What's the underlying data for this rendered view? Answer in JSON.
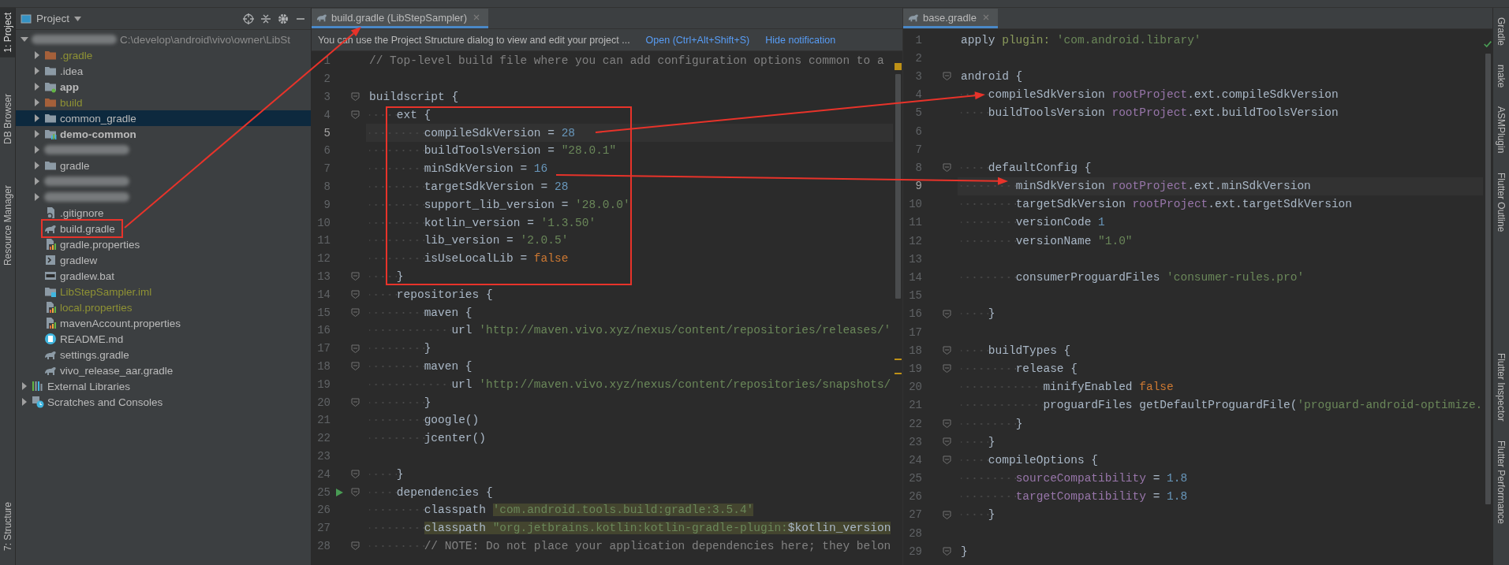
{
  "left_toolstrip": [
    {
      "label": "1: Project",
      "selected": true
    },
    {
      "label": "DB Browser",
      "selected": false
    },
    {
      "label": "Resource Manager",
      "selected": false
    },
    {
      "label": "7: Structure",
      "selected": false
    }
  ],
  "project_panel": {
    "title": "Project",
    "tree": [
      {
        "kind": "root",
        "redacted": true,
        "path": "C:\\develop\\android\\vivo\\owner\\LibSt",
        "expanded": true,
        "selected": false,
        "children": [
          {
            "kind": "excluded-folder",
            "label": ".gradle",
            "ignored": true,
            "expanded": false,
            "selected": false
          },
          {
            "kind": "folder",
            "label": ".idea",
            "expanded": false,
            "selected": false
          },
          {
            "kind": "module",
            "label": "app",
            "expanded": false,
            "selected": false
          },
          {
            "kind": "excluded-folder",
            "label": "build",
            "ignored": true,
            "expanded": false,
            "selected": false
          },
          {
            "kind": "folder",
            "label": "common_gradle",
            "expanded": false,
            "selected": true
          },
          {
            "kind": "module-lib",
            "label": "demo-common",
            "expanded": false,
            "selected": false
          },
          {
            "kind": "module-lib",
            "redacted": true,
            "expanded": false,
            "selected": false
          },
          {
            "kind": "folder",
            "label": "gradle",
            "expanded": false,
            "selected": false
          },
          {
            "kind": "module-lib",
            "redacted": true,
            "expanded": false,
            "selected": false
          },
          {
            "kind": "module-lib",
            "redacted": true,
            "expanded": false,
            "selected": false
          },
          {
            "kind": "ignore-file",
            "label": ".gitignore",
            "selected": false
          },
          {
            "kind": "gradle",
            "label": "build.gradle",
            "selected": false
          },
          {
            "kind": "properties",
            "label": "gradle.properties",
            "selected": false
          },
          {
            "kind": "script",
            "label": "gradlew",
            "selected": false
          },
          {
            "kind": "batch",
            "label": "gradlew.bat",
            "selected": false
          },
          {
            "kind": "iml",
            "label": "LibStepSampler.iml",
            "ignored": true,
            "selected": false
          },
          {
            "kind": "properties",
            "label": "local.properties",
            "ignored": true,
            "selected": false
          },
          {
            "kind": "properties",
            "label": "mavenAccount.properties",
            "selected": false
          },
          {
            "kind": "markdown",
            "label": "README.md",
            "selected": false
          },
          {
            "kind": "gradle",
            "label": "settings.gradle",
            "selected": false
          },
          {
            "kind": "gradle",
            "label": "vivo_release_aar.gradle",
            "selected": false
          }
        ]
      },
      {
        "kind": "libraries",
        "label": "External Libraries",
        "expanded": false,
        "selected": false
      },
      {
        "kind": "scratches",
        "label": "Scratches and Consoles",
        "expanded": false,
        "selected": false
      }
    ]
  },
  "left_editor": {
    "tab": "build.gradle (LibStepSampler)",
    "notification": {
      "text": "You can use the Project Structure dialog to view and edit your project ...",
      "links": [
        "Open (Ctrl+Alt+Shift+S)",
        "Hide notification"
      ]
    },
    "lines": [
      {
        "n": "1",
        "tokens": [
          {
            "t": "// Top-level build file where you can add configuration options common to a",
            "kind": "comment"
          }
        ]
      },
      {
        "n": "2"
      },
      {
        "n": "3",
        "fold": true,
        "tokens": [
          {
            "t": "buildscript {",
            "kind": "plain"
          }
        ]
      },
      {
        "n": "4",
        "fold": true,
        "tokens": [
          {
            "t": "    ext {",
            "kind": "plain"
          }
        ]
      },
      {
        "n": "5",
        "current": true,
        "tokens": [
          {
            "t": "        compileSdkVersion = ",
            "kind": "plain"
          },
          {
            "t": "28",
            "kind": "number"
          }
        ]
      },
      {
        "n": "6",
        "tokens": [
          {
            "t": "        buildToolsVersion = ",
            "kind": "plain"
          },
          {
            "t": "\"28.0.1\"",
            "kind": "string"
          }
        ]
      },
      {
        "n": "7",
        "tokens": [
          {
            "t": "        minSdkVersion = ",
            "kind": "plain"
          },
          {
            "t": "16",
            "kind": "number"
          }
        ]
      },
      {
        "n": "8",
        "tokens": [
          {
            "t": "        targetSdkVersion = ",
            "kind": "plain"
          },
          {
            "t": "28",
            "kind": "number"
          }
        ]
      },
      {
        "n": "9",
        "tokens": [
          {
            "t": "        support_lib_version = ",
            "kind": "plain"
          },
          {
            "t": "'28.0.0'",
            "kind": "string"
          }
        ]
      },
      {
        "n": "10",
        "tokens": [
          {
            "t": "        kotlin_version = ",
            "kind": "plain"
          },
          {
            "t": "'1.3.50'",
            "kind": "string"
          }
        ]
      },
      {
        "n": "11",
        "tokens": [
          {
            "t": "        lib_version = ",
            "kind": "plain"
          },
          {
            "t": "'2.0.5'",
            "kind": "string"
          }
        ]
      },
      {
        "n": "12",
        "tokens": [
          {
            "t": "        isUseLocalLib = ",
            "kind": "plain"
          },
          {
            "t": "false",
            "kind": "keyword"
          }
        ]
      },
      {
        "n": "13",
        "fold": true,
        "tokens": [
          {
            "t": "    }",
            "kind": "plain"
          }
        ]
      },
      {
        "n": "14",
        "fold": true,
        "tokens": [
          {
            "t": "    repositories {",
            "kind": "plain"
          }
        ]
      },
      {
        "n": "15",
        "fold": true,
        "tokens": [
          {
            "t": "        maven {",
            "kind": "plain"
          }
        ]
      },
      {
        "n": "16",
        "tokens": [
          {
            "t": "            url ",
            "kind": "plain"
          },
          {
            "t": "'http://maven.vivo.xyz/nexus/content/repositories/releases/'",
            "kind": "string"
          }
        ]
      },
      {
        "n": "17",
        "fold": true,
        "tokens": [
          {
            "t": "        }",
            "kind": "plain"
          }
        ]
      },
      {
        "n": "18",
        "fold": true,
        "tokens": [
          {
            "t": "        maven {",
            "kind": "plain"
          }
        ]
      },
      {
        "n": "19",
        "tokens": [
          {
            "t": "            url ",
            "kind": "plain"
          },
          {
            "t": "'http://maven.vivo.xyz/nexus/content/repositories/snapshots/",
            "kind": "string"
          }
        ]
      },
      {
        "n": "20",
        "fold": true,
        "tokens": [
          {
            "t": "        }",
            "kind": "plain"
          }
        ]
      },
      {
        "n": "21",
        "tokens": [
          {
            "t": "        google()",
            "kind": "plain"
          }
        ]
      },
      {
        "n": "22",
        "tokens": [
          {
            "t": "        jcenter()",
            "kind": "plain"
          }
        ]
      },
      {
        "n": "23"
      },
      {
        "n": "24",
        "fold": true,
        "tokens": [
          {
            "t": "    }",
            "kind": "plain"
          }
        ]
      },
      {
        "n": "25",
        "fold": true,
        "run": true,
        "tokens": [
          {
            "t": "    dependencies {",
            "kind": "plain"
          }
        ]
      },
      {
        "n": "26",
        "tokens": [
          {
            "t": "        classpath ",
            "kind": "plain"
          },
          {
            "t": "'com.android.tools.build:gradle:3.5.4'",
            "kind": "string",
            "marked": true
          }
        ]
      },
      {
        "n": "27",
        "tokens": [
          {
            "t": "        classpath ",
            "kind": "plain",
            "marked": true
          },
          {
            "t": "\"org.jetbrains.kotlin:kotlin-gradle-plugin:",
            "kind": "string",
            "marked": true
          },
          {
            "t": "$kotlin_version",
            "kind": "plain",
            "marked": true
          }
        ]
      },
      {
        "n": "28",
        "fold": true,
        "tokens": [
          {
            "t": "        // NOTE: Do not place your application dependencies here; they belon",
            "kind": "comment"
          }
        ]
      }
    ]
  },
  "right_editor": {
    "tab": "base.gradle",
    "lines": [
      {
        "n": "1",
        "tokens": [
          {
            "t": "apply ",
            "kind": "plain"
          },
          {
            "t": "plugin: ",
            "kind": "named"
          },
          {
            "t": "'com.android.library'",
            "kind": "string"
          }
        ]
      },
      {
        "n": "2"
      },
      {
        "n": "3",
        "fold": true,
        "tokens": [
          {
            "t": "android {",
            "kind": "plain"
          }
        ]
      },
      {
        "n": "4",
        "tokens": [
          {
            "t": "    compileSdkVersion ",
            "kind": "plain"
          },
          {
            "t": "rootProject",
            "kind": "property"
          },
          {
            "t": ".ext.compileSdkVersion",
            "kind": "plain"
          }
        ]
      },
      {
        "n": "5",
        "tokens": [
          {
            "t": "    buildToolsVersion ",
            "kind": "plain"
          },
          {
            "t": "rootProject",
            "kind": "property"
          },
          {
            "t": ".ext.buildToolsVersion",
            "kind": "plain"
          }
        ]
      },
      {
        "n": "6"
      },
      {
        "n": "7"
      },
      {
        "n": "8",
        "fold": true,
        "tokens": [
          {
            "t": "    defaultConfig {",
            "kind": "plain"
          }
        ]
      },
      {
        "n": "9",
        "current": true,
        "tokens": [
          {
            "t": "        minSdkVersion ",
            "kind": "plain"
          },
          {
            "t": "rootProject",
            "kind": "property"
          },
          {
            "t": ".ext.minSdkVersion",
            "kind": "plain"
          }
        ]
      },
      {
        "n": "10",
        "tokens": [
          {
            "t": "        targetSdkVersion ",
            "kind": "plain"
          },
          {
            "t": "rootProject",
            "kind": "property"
          },
          {
            "t": ".ext.targetSdkVersion",
            "kind": "plain"
          }
        ]
      },
      {
        "n": "11",
        "tokens": [
          {
            "t": "        versionCode ",
            "kind": "plain"
          },
          {
            "t": "1",
            "kind": "number"
          }
        ]
      },
      {
        "n": "12",
        "tokens": [
          {
            "t": "        versionName ",
            "kind": "plain"
          },
          {
            "t": "\"1.0\"",
            "kind": "string"
          }
        ]
      },
      {
        "n": "13"
      },
      {
        "n": "14",
        "tokens": [
          {
            "t": "        consumerProguardFiles ",
            "kind": "plain"
          },
          {
            "t": "'consumer-rules.pro'",
            "kind": "string"
          }
        ]
      },
      {
        "n": "15"
      },
      {
        "n": "16",
        "fold": true,
        "tokens": [
          {
            "t": "    }",
            "kind": "plain"
          }
        ]
      },
      {
        "n": "17"
      },
      {
        "n": "18",
        "fold": true,
        "tokens": [
          {
            "t": "    buildTypes {",
            "kind": "plain"
          }
        ]
      },
      {
        "n": "19",
        "fold": true,
        "tokens": [
          {
            "t": "        release {",
            "kind": "plain"
          }
        ]
      },
      {
        "n": "20",
        "tokens": [
          {
            "t": "            minifyEnabled ",
            "kind": "plain"
          },
          {
            "t": "false",
            "kind": "keyword"
          }
        ]
      },
      {
        "n": "21",
        "tokens": [
          {
            "t": "            proguardFiles getDefaultProguardFile(",
            "kind": "plain"
          },
          {
            "t": "'proguard-android-optimize.",
            "kind": "string"
          }
        ]
      },
      {
        "n": "22",
        "fold": true,
        "tokens": [
          {
            "t": "        }",
            "kind": "plain"
          }
        ]
      },
      {
        "n": "23",
        "fold": true,
        "tokens": [
          {
            "t": "    }",
            "kind": "plain"
          }
        ]
      },
      {
        "n": "24",
        "fold": true,
        "tokens": [
          {
            "t": "    compileOptions {",
            "kind": "plain"
          }
        ]
      },
      {
        "n": "25",
        "tokens": [
          {
            "t": "        sourceCompatibility",
            "kind": "property"
          },
          {
            "t": " = ",
            "kind": "plain"
          },
          {
            "t": "1.8",
            "kind": "number"
          }
        ]
      },
      {
        "n": "26",
        "tokens": [
          {
            "t": "        targetCompatibility",
            "kind": "property"
          },
          {
            "t": " = ",
            "kind": "plain"
          },
          {
            "t": "1.8",
            "kind": "number"
          }
        ]
      },
      {
        "n": "27",
        "fold": true,
        "tokens": [
          {
            "t": "    }",
            "kind": "plain"
          }
        ]
      },
      {
        "n": "28"
      },
      {
        "n": "29",
        "fold": true,
        "tokens": [
          {
            "t": "}",
            "kind": "plain"
          }
        ]
      }
    ]
  },
  "right_toolstrip": [
    {
      "label": "Gradle",
      "selected": false
    },
    {
      "label": "make",
      "selected": false
    },
    {
      "label": "ASMPlugin",
      "selected": false
    },
    {
      "label": "Flutter Outline",
      "selected": false
    },
    {
      "label": "Flutter Inspector",
      "selected": false
    },
    {
      "label": "Flutter Performance",
      "selected": false
    }
  ]
}
